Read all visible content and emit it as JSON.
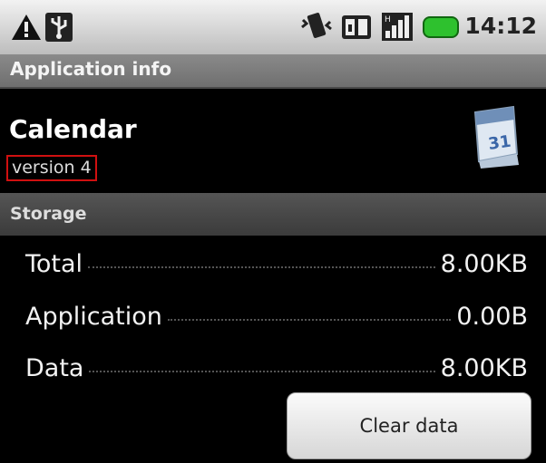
{
  "status_bar": {
    "time": "14:12",
    "icons": [
      "warning-icon",
      "usb-icon",
      "vibrate-icon",
      "sd-card-icon",
      "signal-icon",
      "battery-icon"
    ],
    "battery_color": "#2ec12e"
  },
  "title_bar": {
    "title": "Application info"
  },
  "app": {
    "name": "Calendar",
    "version": "version 4",
    "icon": "calendar-app-icon",
    "icon_day": "31"
  },
  "storage": {
    "header": "Storage",
    "rows": [
      {
        "label": "Total",
        "value": "8.00KB"
      },
      {
        "label": "Application",
        "value": "0.00B"
      },
      {
        "label": "Data",
        "value": "8.00KB"
      }
    ],
    "clear_button": "Clear data"
  },
  "colors": {
    "highlight_box": "#d01010",
    "title_bar": "#7d7d7d",
    "section_header": "#484848"
  }
}
